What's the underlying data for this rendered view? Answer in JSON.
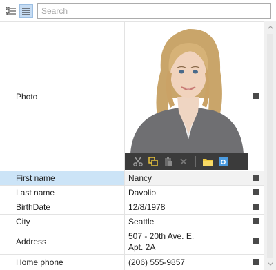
{
  "toolbar": {
    "categorized_icon": "categorized-view-icon",
    "alphabetical_icon": "alphabetical-view-icon",
    "search_placeholder": "Search"
  },
  "photo": {
    "label": "Photo",
    "tools": [
      "cut-icon",
      "copy-icon",
      "paste-icon",
      "delete-icon",
      "open-folder-icon",
      "load-image-icon"
    ]
  },
  "properties": [
    {
      "label": "First name",
      "value": "Nancy"
    },
    {
      "label": "Last name",
      "value": "Davolio"
    },
    {
      "label": "BirthDate",
      "value": "12/8/1978"
    },
    {
      "label": "City",
      "value": "Seattle"
    },
    {
      "label": "Address",
      "value_line1": "507 - 20th Ave. E.",
      "value_line2": "Apt. 2A"
    },
    {
      "label": "Home phone",
      "value": "(206) 555-9857"
    }
  ],
  "colors": {
    "selected_label_bg": "#cce4f7",
    "active_toolbar_bg": "#c6dcf3"
  }
}
